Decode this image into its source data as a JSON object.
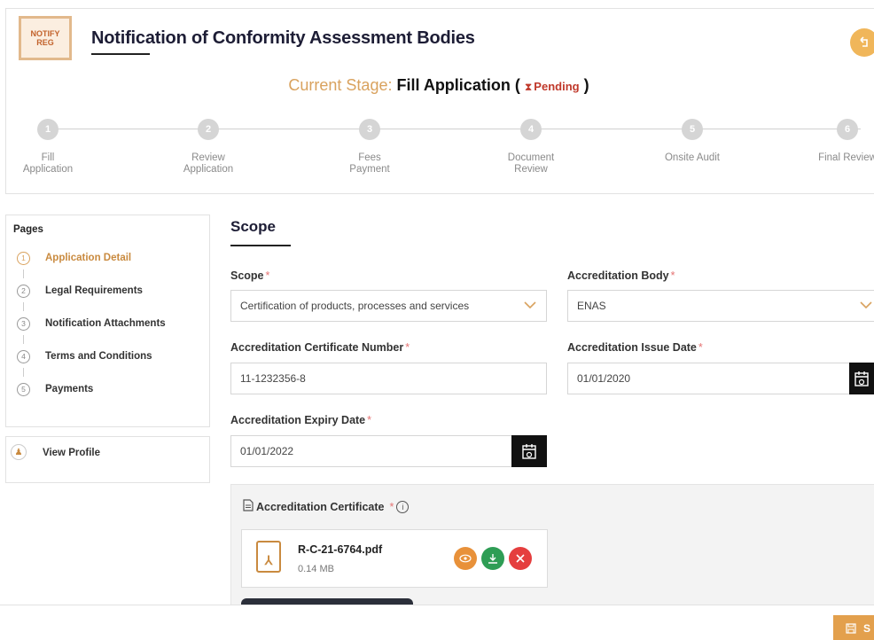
{
  "header": {
    "logo_line1": "NOTIFY",
    "logo_line2": "REG",
    "title": "Notification of Conformity Assessment Bodies",
    "stage_label": "Current Stage:",
    "stage_value": "Fill Application",
    "stage_status": "Pending",
    "back_icon": "back-arrow-icon"
  },
  "steps": [
    {
      "num": "1",
      "label": "Fill\nApplication"
    },
    {
      "num": "2",
      "label": "Review\nApplication"
    },
    {
      "num": "3",
      "label": "Fees\nPayment"
    },
    {
      "num": "4",
      "label": "Document\nReview"
    },
    {
      "num": "5",
      "label": "Onsite Audit"
    },
    {
      "num": "6",
      "label": "Final Review"
    }
  ],
  "sidebar": {
    "title": "Pages",
    "items": [
      {
        "num": "1",
        "label": "Application Detail",
        "active": true
      },
      {
        "num": "2",
        "label": "Legal Requirements"
      },
      {
        "num": "3",
        "label": "Notification Attachments"
      },
      {
        "num": "4",
        "label": "Terms and Conditions"
      },
      {
        "num": "5",
        "label": "Payments"
      }
    ],
    "profile_label": "View Profile"
  },
  "form": {
    "section_title": "Scope",
    "scope_label": "Scope",
    "scope_value": "Certification of products, processes and services",
    "body_label": "Accreditation Body",
    "body_value": "ENAS",
    "cert_num_label": "Accreditation Certificate Number",
    "cert_num_value": "11-1232356-8",
    "issue_label": "Accreditation Issue Date",
    "issue_value": "01/01/2020",
    "expiry_label": "Accreditation Expiry Date",
    "expiry_value": "01/01/2022",
    "required_mark": "*"
  },
  "attachment": {
    "title": "Accreditation Certificate",
    "file_name": "R-C-21-6764.pdf",
    "file_size": "0.14 MB"
  },
  "footer": {
    "submit_label": "S"
  },
  "colors": {
    "accent": "#d9a25e",
    "view": "#e8913a",
    "download": "#2e9d55",
    "delete": "#e53e3e"
  }
}
